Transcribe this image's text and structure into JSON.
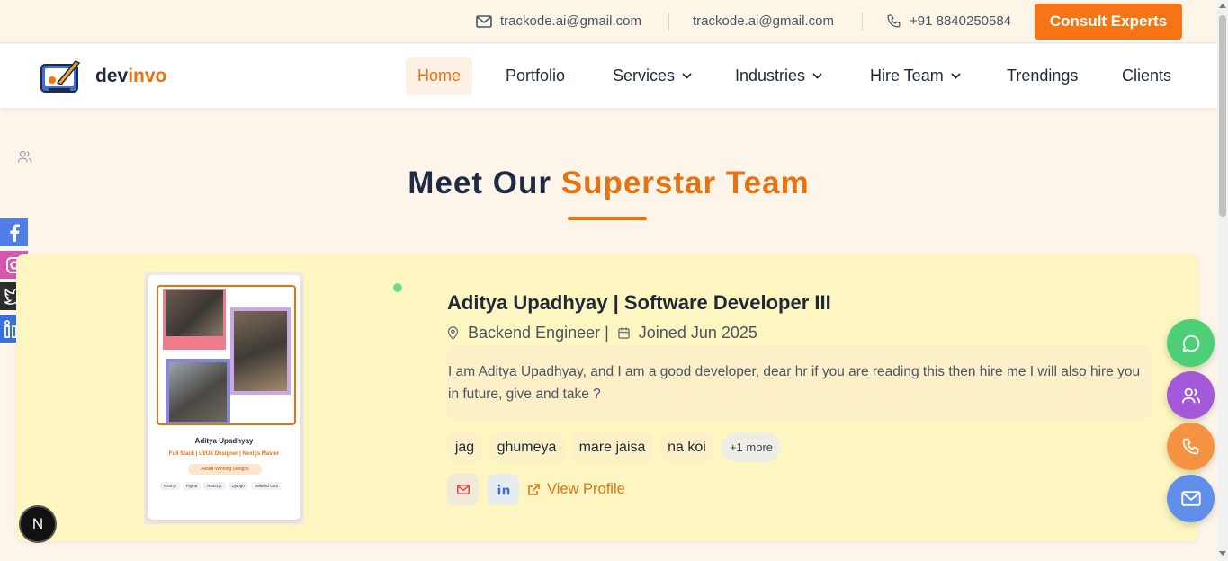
{
  "topbar": {
    "email_1": "trackode.ai@gmail.com",
    "email_2": "trackode.ai@gmail.com",
    "phone": "+91 8840250584",
    "consult_label": "Consult Experts"
  },
  "brand": {
    "part1": "dev",
    "part2": "invo"
  },
  "nav": {
    "home": "Home",
    "portfolio": "Portfolio",
    "services": "Services",
    "industries": "Industries",
    "hire_team": "Hire Team",
    "trendings": "Trendings",
    "clients": "Clients"
  },
  "heading": {
    "part1": "Meet Our",
    "part2": "Superstar Team"
  },
  "member": {
    "title": "Aditya Upadhyay | Software Developer III",
    "role": "Backend Engineer |",
    "joined": "Joined Jun 2025",
    "bio": "I am Aditya Upadhyay, and I am a good developer, dear hr if you are reading this then hire me I will also hire you in future, give and take ?",
    "tags": [
      "jag",
      "ghumeya",
      "mare jaisa",
      "na koi"
    ],
    "more_tags": "+1 more",
    "view_profile": "View Profile",
    "photo": {
      "name": "Aditya Upadhyay",
      "role": "Full Stack | UI/UX Designer | Next.js Master",
      "badge": "Award-Winning Designs",
      "tags": [
        "Next.js",
        "Figma",
        "React.js",
        "Django",
        "Tailwind CSS"
      ]
    }
  },
  "badge_letter": "N",
  "colors": {
    "accent": "#e8720f",
    "facebook": "#4f7fe6",
    "instagram": "#d955b0",
    "twitter": "#2d2d2d",
    "linkedin": "#3b6fd8",
    "fab_chat": "#4ccf76",
    "fab_team": "#a35ad9",
    "fab_phone": "#f59342",
    "fab_mail": "#5f8fe8"
  }
}
